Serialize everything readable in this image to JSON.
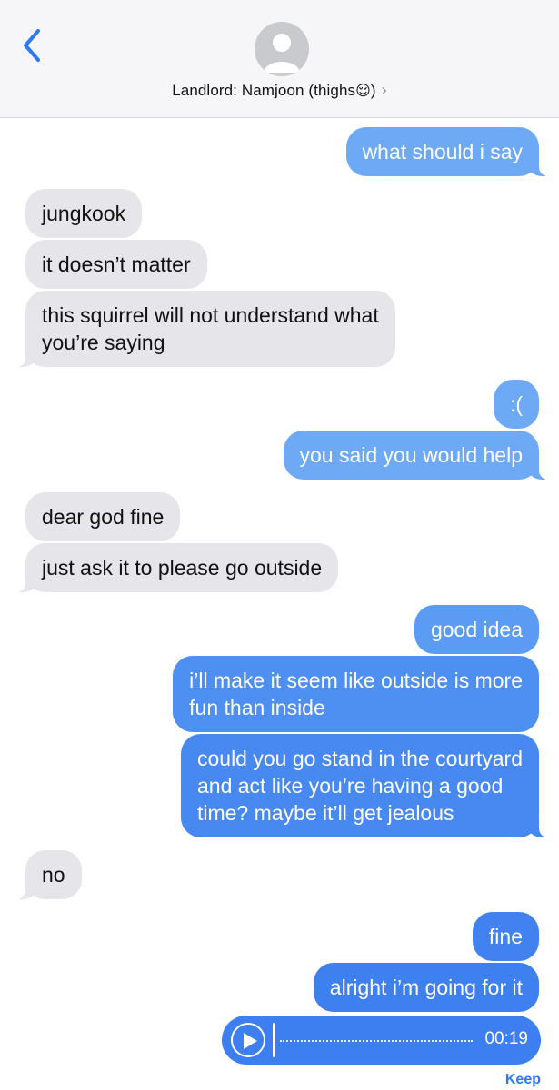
{
  "header": {
    "back_icon": "chevron-left-icon",
    "avatar_icon": "person-silhouette-icon",
    "contact_name": "Landlord: Namjoon (thighs",
    "contact_emoji": "😌",
    "contact_suffix": ")",
    "chevron": "›"
  },
  "messages": [
    {
      "side": "out",
      "text": "what should i say"
    },
    {
      "side": "in",
      "text": "jungkook"
    },
    {
      "side": "in",
      "text": "it doesn’t matter"
    },
    {
      "side": "in",
      "lines": [
        "this squirrel will not understand what",
        "you’re saying"
      ]
    },
    {
      "side": "out",
      "text": ":("
    },
    {
      "side": "out",
      "text": "you said you would help"
    },
    {
      "side": "in",
      "text": "dear god fine"
    },
    {
      "side": "in",
      "text": "just ask it to please go outside"
    },
    {
      "side": "out",
      "text": "good idea"
    },
    {
      "side": "out",
      "lines": [
        "i’ll make it seem like outside is more",
        "fun than inside"
      ]
    },
    {
      "side": "out",
      "lines": [
        "could you go stand in the courtyard",
        "and act like you’re having a good",
        "time? maybe it’ll get jealous"
      ]
    },
    {
      "side": "in",
      "text": "no"
    },
    {
      "side": "out",
      "text": "fine"
    },
    {
      "side": "out",
      "text": "alright i’m going for it"
    }
  ],
  "audio_message": {
    "duration": "00:19",
    "play_icon": "play-icon",
    "keep_label": "Keep"
  },
  "colors": {
    "incoming_bubble": "#e5e5ea",
    "outgoing_light": "#6ea9f5",
    "outgoing_mid": "#4e8ff2",
    "outgoing_dark": "#3d7ff0",
    "accent": "#2f78f6"
  }
}
